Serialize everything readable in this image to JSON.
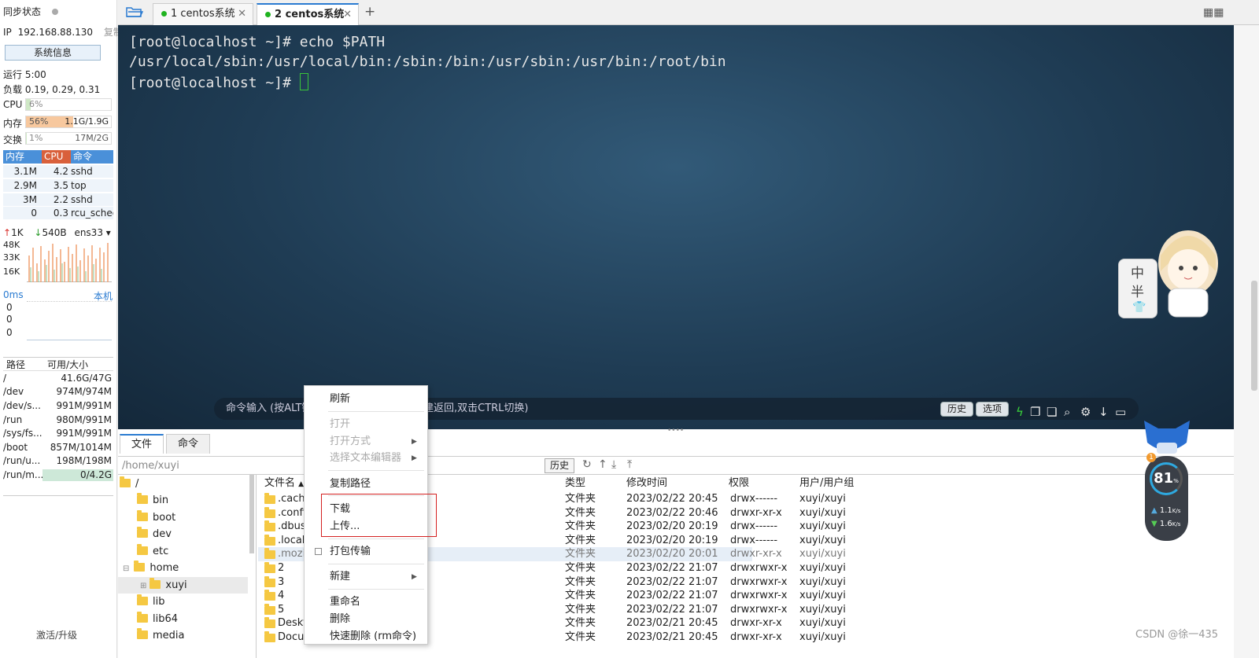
{
  "sidebar": {
    "sync_status": "同步状态",
    "ip_label": "IP",
    "ip_value": "192.168.88.130",
    "copy": "复制",
    "sysinfo_button": "系统信息",
    "uptime": "运行 5:00",
    "load": "负载 0.19, 0.29, 0.31",
    "cpu_label": "CPU",
    "cpu_value": "6%",
    "cpu_level": 6,
    "mem_label": "内存",
    "mem_percent": "56%",
    "mem_value": "1.1G/1.9G",
    "mem_level": 56,
    "swap_label": "交换",
    "swap_percent": "1%",
    "swap_value": "17M/2G",
    "swap_level": 1,
    "proc_headers": [
      "内存",
      "CPU",
      "命令"
    ],
    "processes": [
      {
        "mem": "3.1M",
        "cpu": "4.2",
        "cmd": "sshd"
      },
      {
        "mem": "2.9M",
        "cpu": "3.5",
        "cmd": "top"
      },
      {
        "mem": "3M",
        "cpu": "2.2",
        "cmd": "sshd"
      },
      {
        "mem": "0",
        "cpu": "0.3",
        "cmd": "rcu_sched"
      }
    ],
    "net_up": "1K",
    "net_down": "540B",
    "net_iface": "ens33",
    "net_scale": [
      "48K",
      "33K",
      "16K"
    ],
    "latency": "0ms",
    "latency_host": "本机",
    "latency_vals": [
      "0",
      "0",
      "0"
    ],
    "disk_headers": [
      "路径",
      "可用/大小"
    ],
    "disks": [
      {
        "path": "/",
        "value": "41.6G/47G"
      },
      {
        "path": "/dev",
        "value": "974M/974M"
      },
      {
        "path": "/dev/s...",
        "value": "991M/991M"
      },
      {
        "path": "/run",
        "value": "980M/991M"
      },
      {
        "path": "/sys/fs...",
        "value": "991M/991M"
      },
      {
        "path": "/boot",
        "value": "857M/1014M"
      },
      {
        "path": "/run/u...",
        "value": "198M/198M"
      },
      {
        "path": "/run/m...",
        "value": "0/4.2G"
      }
    ],
    "activate": "激活/升级"
  },
  "tabs": [
    {
      "label": "1 centos系统"
    },
    {
      "label": "2 centos系统"
    }
  ],
  "terminal": {
    "lines": [
      "[root@localhost ~]# echo $PATH",
      "/usr/local/sbin:/usr/local/bin:/sbin:/bin:/usr/sbin:/usr/bin:/root/bin",
      "[root@localhost ~]# "
    ],
    "cmd_placeholder": "命令输入 (按ALT键",
    "cmd_placeholder_tail": "建返回,双击CTRL切换)",
    "history_btn": "历史",
    "options_btn": "选项"
  },
  "mascot_text": [
    "中",
    "半"
  ],
  "files": {
    "tab_files": "文件",
    "tab_cmd": "命令",
    "path": "/home/xuyi",
    "history_btn": "历史",
    "tree": [
      {
        "name": "/",
        "level": 0
      },
      {
        "name": "bin",
        "level": 1
      },
      {
        "name": "boot",
        "level": 1
      },
      {
        "name": "dev",
        "level": 1
      },
      {
        "name": "etc",
        "level": 1
      },
      {
        "name": "home",
        "level": 1
      },
      {
        "name": "xuyi",
        "level": 2
      },
      {
        "name": "lib",
        "level": 1
      },
      {
        "name": "lib64",
        "level": 1
      },
      {
        "name": "media",
        "level": 1
      }
    ],
    "headers": {
      "name": "文件名",
      "type": "类型",
      "mtime": "修改时间",
      "perm": "权限",
      "owner": "用户/用户组"
    },
    "rows": [
      {
        "name": ".cache",
        "type": "文件夹",
        "mtime": "2023/02/22 20:45",
        "perm": "drwx------",
        "owner": "xuyi/xuyi"
      },
      {
        "name": ".config",
        "type": "文件夹",
        "mtime": "2023/02/22 20:46",
        "perm": "drwxr-xr-x",
        "owner": "xuyi/xuyi"
      },
      {
        "name": ".dbus",
        "type": "文件夹",
        "mtime": "2023/02/20 20:19",
        "perm": "drwx------",
        "owner": "xuyi/xuyi"
      },
      {
        "name": ".local",
        "type": "文件夹",
        "mtime": "2023/02/20 20:19",
        "perm": "drwx------",
        "owner": "xuyi/xuyi"
      },
      {
        "name": ".mozilla",
        "type": "文件夹",
        "mtime": "2023/02/20 20:01",
        "perm": "drwxr-xr-x",
        "owner": "xuyi/xuyi"
      },
      {
        "name": "2",
        "type": "文件夹",
        "mtime": "2023/02/22 21:07",
        "perm": "drwxrwxr-x",
        "owner": "xuyi/xuyi"
      },
      {
        "name": "3",
        "type": "文件夹",
        "mtime": "2023/02/22 21:07",
        "perm": "drwxrwxr-x",
        "owner": "xuyi/xuyi"
      },
      {
        "name": "4",
        "type": "文件夹",
        "mtime": "2023/02/22 21:07",
        "perm": "drwxrwxr-x",
        "owner": "xuyi/xuyi"
      },
      {
        "name": "5",
        "type": "文件夹",
        "mtime": "2023/02/22 21:07",
        "perm": "drwxrwxr-x",
        "owner": "xuyi/xuyi"
      },
      {
        "name": "Desktop",
        "type": "文件夹",
        "mtime": "2023/02/21 20:45",
        "perm": "drwxr-xr-x",
        "owner": "xuyi/xuyi"
      },
      {
        "name": "Documents",
        "type": "文件夹",
        "mtime": "2023/02/21 20:45",
        "perm": "drwxr-xr-x",
        "owner": "xuyi/xuyi"
      }
    ]
  },
  "context_menu": {
    "refresh": "刷新",
    "open": "打开",
    "open_with": "打开方式",
    "choose_editor": "选择文本编辑器",
    "copy_path": "复制路径",
    "download": "下载",
    "upload": "上传...",
    "pack_transfer": "打包传输",
    "new": "新建",
    "rename": "重命名",
    "delete": "删除",
    "quick_delete": "快速删除 (rm命令)"
  },
  "monitor": {
    "badge": "1",
    "value": "81",
    "unit": "%",
    "up": "1.1",
    "down": "1.6",
    "rate_unit": "K/s"
  },
  "watermark": "CSDN @徐一435",
  "colors": {
    "accent": "#2a7bd1",
    "cpu_head": "#d9603b",
    "mem_fill": "#f7c89e",
    "red_box": "#d42020"
  }
}
